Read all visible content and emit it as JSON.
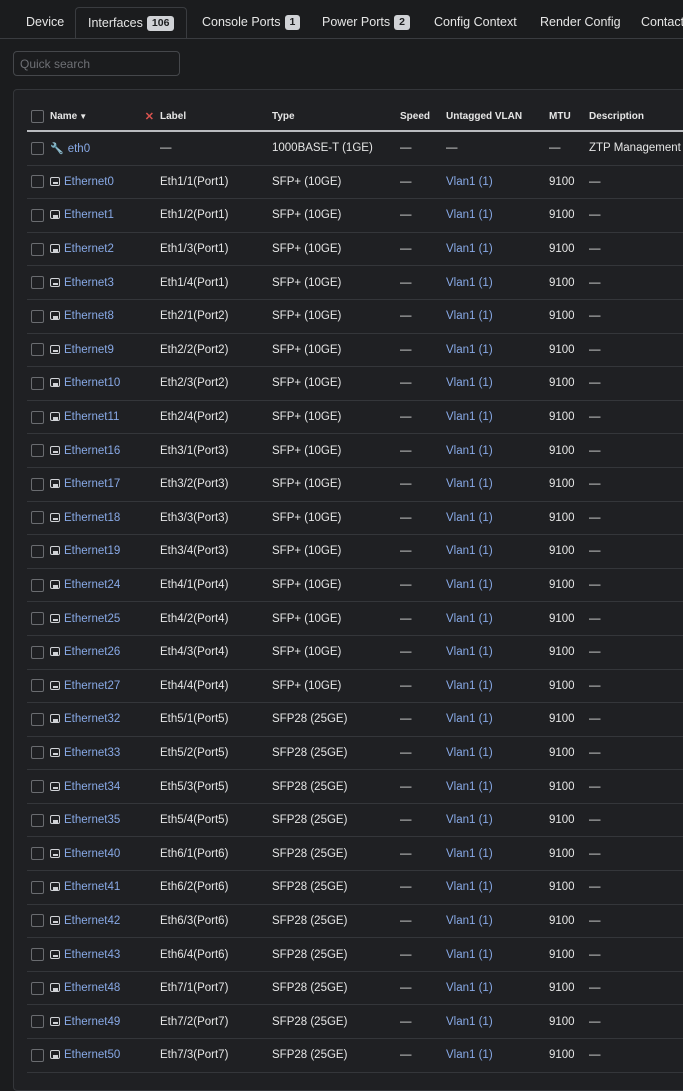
{
  "tabs": [
    {
      "label": "Device",
      "badge": null,
      "active": false
    },
    {
      "label": "Interfaces",
      "badge": "106",
      "active": true
    },
    {
      "label": "Console Ports",
      "badge": "1",
      "active": false
    },
    {
      "label": "Power Ports",
      "badge": "2",
      "active": false
    },
    {
      "label": "Config Context",
      "badge": null,
      "active": false
    },
    {
      "label": "Render Config",
      "badge": null,
      "active": false
    },
    {
      "label": "Contacts",
      "badge": null,
      "active": false
    }
  ],
  "search": {
    "placeholder": "Quick search",
    "value": ""
  },
  "table": {
    "columns": {
      "name": "Name",
      "label": "Label",
      "type": "Type",
      "speed": "Speed",
      "untagged_vlan": "Untagged VLAN",
      "mtu": "MTU",
      "description": "Description"
    },
    "rows": [
      {
        "icon": "wrench-icon",
        "name": "eth0",
        "label": "—",
        "type": "1000BASE-T (1GE)",
        "speed": "—",
        "vlan": "—",
        "mtu": "—",
        "description": "ZTP Management"
      },
      {
        "icon": "interface-port-icon",
        "name": "Ethernet0",
        "label": "Eth1/1(Port1)",
        "type": "SFP+ (10GE)",
        "speed": "—",
        "vlan": "Vlan1 (1)",
        "mtu": "9100",
        "description": "—"
      },
      {
        "icon": "interface-port-icon",
        "name": "Ethernet1",
        "label": "Eth1/2(Port1)",
        "type": "SFP+ (10GE)",
        "speed": "—",
        "vlan": "Vlan1 (1)",
        "mtu": "9100",
        "description": "—"
      },
      {
        "icon": "interface-port-icon",
        "name": "Ethernet2",
        "label": "Eth1/3(Port1)",
        "type": "SFP+ (10GE)",
        "speed": "—",
        "vlan": "Vlan1 (1)",
        "mtu": "9100",
        "description": "—"
      },
      {
        "icon": "interface-port-icon",
        "name": "Ethernet3",
        "label": "Eth1/4(Port1)",
        "type": "SFP+ (10GE)",
        "speed": "—",
        "vlan": "Vlan1 (1)",
        "mtu": "9100",
        "description": "—"
      },
      {
        "icon": "interface-port-icon",
        "name": "Ethernet8",
        "label": "Eth2/1(Port2)",
        "type": "SFP+ (10GE)",
        "speed": "—",
        "vlan": "Vlan1 (1)",
        "mtu": "9100",
        "description": "—"
      },
      {
        "icon": "interface-port-icon",
        "name": "Ethernet9",
        "label": "Eth2/2(Port2)",
        "type": "SFP+ (10GE)",
        "speed": "—",
        "vlan": "Vlan1 (1)",
        "mtu": "9100",
        "description": "—"
      },
      {
        "icon": "interface-port-icon",
        "name": "Ethernet10",
        "label": "Eth2/3(Port2)",
        "type": "SFP+ (10GE)",
        "speed": "—",
        "vlan": "Vlan1 (1)",
        "mtu": "9100",
        "description": "—"
      },
      {
        "icon": "interface-port-icon",
        "name": "Ethernet11",
        "label": "Eth2/4(Port2)",
        "type": "SFP+ (10GE)",
        "speed": "—",
        "vlan": "Vlan1 (1)",
        "mtu": "9100",
        "description": "—"
      },
      {
        "icon": "interface-port-icon",
        "name": "Ethernet16",
        "label": "Eth3/1(Port3)",
        "type": "SFP+ (10GE)",
        "speed": "—",
        "vlan": "Vlan1 (1)",
        "mtu": "9100",
        "description": "—"
      },
      {
        "icon": "interface-port-icon",
        "name": "Ethernet17",
        "label": "Eth3/2(Port3)",
        "type": "SFP+ (10GE)",
        "speed": "—",
        "vlan": "Vlan1 (1)",
        "mtu": "9100",
        "description": "—"
      },
      {
        "icon": "interface-port-icon",
        "name": "Ethernet18",
        "label": "Eth3/3(Port3)",
        "type": "SFP+ (10GE)",
        "speed": "—",
        "vlan": "Vlan1 (1)",
        "mtu": "9100",
        "description": "—"
      },
      {
        "icon": "interface-port-icon",
        "name": "Ethernet19",
        "label": "Eth3/4(Port3)",
        "type": "SFP+ (10GE)",
        "speed": "—",
        "vlan": "Vlan1 (1)",
        "mtu": "9100",
        "description": "—"
      },
      {
        "icon": "interface-port-icon",
        "name": "Ethernet24",
        "label": "Eth4/1(Port4)",
        "type": "SFP+ (10GE)",
        "speed": "—",
        "vlan": "Vlan1 (1)",
        "mtu": "9100",
        "description": "—"
      },
      {
        "icon": "interface-port-icon",
        "name": "Ethernet25",
        "label": "Eth4/2(Port4)",
        "type": "SFP+ (10GE)",
        "speed": "—",
        "vlan": "Vlan1 (1)",
        "mtu": "9100",
        "description": "—"
      },
      {
        "icon": "interface-port-icon",
        "name": "Ethernet26",
        "label": "Eth4/3(Port4)",
        "type": "SFP+ (10GE)",
        "speed": "—",
        "vlan": "Vlan1 (1)",
        "mtu": "9100",
        "description": "—"
      },
      {
        "icon": "interface-port-icon",
        "name": "Ethernet27",
        "label": "Eth4/4(Port4)",
        "type": "SFP+ (10GE)",
        "speed": "—",
        "vlan": "Vlan1 (1)",
        "mtu": "9100",
        "description": "—"
      },
      {
        "icon": "interface-port-icon",
        "name": "Ethernet32",
        "label": "Eth5/1(Port5)",
        "type": "SFP28 (25GE)",
        "speed": "—",
        "vlan": "Vlan1 (1)",
        "mtu": "9100",
        "description": "—"
      },
      {
        "icon": "interface-port-icon",
        "name": "Ethernet33",
        "label": "Eth5/2(Port5)",
        "type": "SFP28 (25GE)",
        "speed": "—",
        "vlan": "Vlan1 (1)",
        "mtu": "9100",
        "description": "—"
      },
      {
        "icon": "interface-port-icon",
        "name": "Ethernet34",
        "label": "Eth5/3(Port5)",
        "type": "SFP28 (25GE)",
        "speed": "—",
        "vlan": "Vlan1 (1)",
        "mtu": "9100",
        "description": "—"
      },
      {
        "icon": "interface-port-icon",
        "name": "Ethernet35",
        "label": "Eth5/4(Port5)",
        "type": "SFP28 (25GE)",
        "speed": "—",
        "vlan": "Vlan1 (1)",
        "mtu": "9100",
        "description": "—"
      },
      {
        "icon": "interface-port-icon",
        "name": "Ethernet40",
        "label": "Eth6/1(Port6)",
        "type": "SFP28 (25GE)",
        "speed": "—",
        "vlan": "Vlan1 (1)",
        "mtu": "9100",
        "description": "—"
      },
      {
        "icon": "interface-port-icon",
        "name": "Ethernet41",
        "label": "Eth6/2(Port6)",
        "type": "SFP28 (25GE)",
        "speed": "—",
        "vlan": "Vlan1 (1)",
        "mtu": "9100",
        "description": "—"
      },
      {
        "icon": "interface-port-icon",
        "name": "Ethernet42",
        "label": "Eth6/3(Port6)",
        "type": "SFP28 (25GE)",
        "speed": "—",
        "vlan": "Vlan1 (1)",
        "mtu": "9100",
        "description": "—"
      },
      {
        "icon": "interface-port-icon",
        "name": "Ethernet43",
        "label": "Eth6/4(Port6)",
        "type": "SFP28 (25GE)",
        "speed": "—",
        "vlan": "Vlan1 (1)",
        "mtu": "9100",
        "description": "—"
      },
      {
        "icon": "interface-port-icon",
        "name": "Ethernet48",
        "label": "Eth7/1(Port7)",
        "type": "SFP28 (25GE)",
        "speed": "—",
        "vlan": "Vlan1 (1)",
        "mtu": "9100",
        "description": "—"
      },
      {
        "icon": "interface-port-icon",
        "name": "Ethernet49",
        "label": "Eth7/2(Port7)",
        "type": "SFP28 (25GE)",
        "speed": "—",
        "vlan": "Vlan1 (1)",
        "mtu": "9100",
        "description": "—"
      },
      {
        "icon": "interface-port-icon",
        "name": "Ethernet50",
        "label": "Eth7/3(Port7)",
        "type": "SFP28 (25GE)",
        "speed": "—",
        "vlan": "Vlan1 (1)",
        "mtu": "9100",
        "description": "—"
      }
    ]
  },
  "colors": {
    "background": "#1b1c1e",
    "link": "#88a9e6",
    "clear_filter": "#d9534f"
  }
}
